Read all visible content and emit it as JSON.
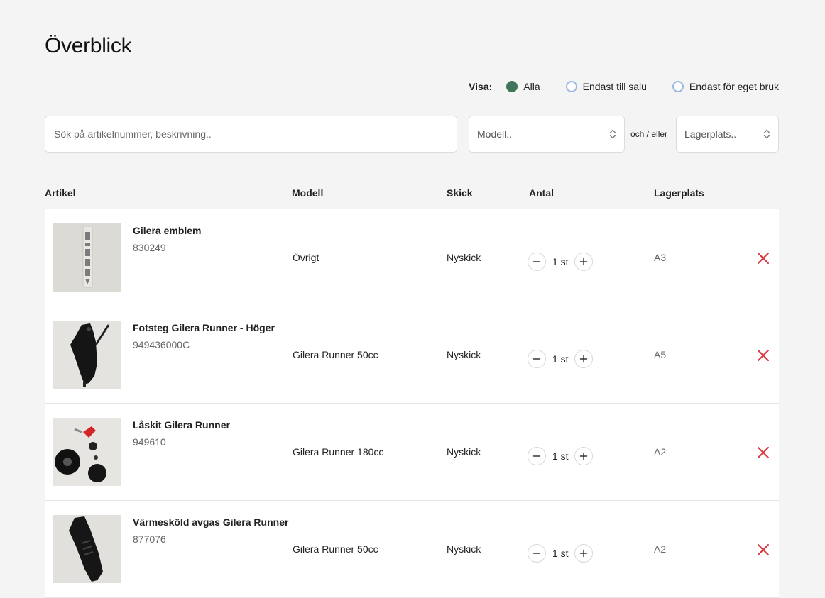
{
  "page": {
    "title": "Överblick"
  },
  "filter": {
    "label": "Visa:",
    "options": [
      {
        "label": "Alla",
        "checked": true
      },
      {
        "label": "Endast till salu",
        "checked": false
      },
      {
        "label": "Endast för eget bruk",
        "checked": false
      }
    ]
  },
  "search": {
    "placeholder": "Sök på artikelnummer, beskrivning.."
  },
  "model_select": {
    "value": "Modell.."
  },
  "connector": "och / eller",
  "location_select": {
    "value": "Lagerplats.."
  },
  "columns": {
    "artikel": "Artikel",
    "modell": "Modell",
    "skick": "Skick",
    "antal": "Antal",
    "lagerplats": "Lagerplats"
  },
  "items": [
    {
      "name": "Gilera emblem",
      "number": "830249",
      "model": "Övrigt",
      "condition": "Nyskick",
      "qty": "1 st",
      "location": "A3",
      "image_icon": "emblem-photo"
    },
    {
      "name": "Fotsteg Gilera Runner - Höger",
      "number": "949436000C",
      "model": "Gilera Runner 50cc",
      "condition": "Nyskick",
      "qty": "1 st",
      "location": "A5",
      "image_icon": "footrest-photo"
    },
    {
      "name": "Låskit Gilera Runner",
      "number": "949610",
      "model": "Gilera Runner 180cc",
      "condition": "Nyskick",
      "qty": "1 st",
      "location": "A2",
      "image_icon": "lock-kit-photo"
    },
    {
      "name": "Värmesköld avgas Gilera Runner",
      "number": "877076",
      "model": "Gilera Runner 50cc",
      "condition": "Nyskick",
      "qty": "1 st",
      "location": "A2",
      "image_icon": "heat-shield-photo"
    }
  ],
  "colors": {
    "radio_checked": "#3f7559",
    "radio_unchecked": "#9bb7e0",
    "delete": "#d9363e"
  }
}
